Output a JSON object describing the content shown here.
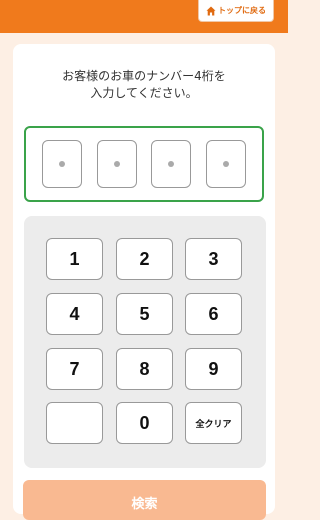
{
  "header": {
    "home_label": "トップに戻る"
  },
  "prompt": {
    "line1": "お客様のお車のナンバー4桁を",
    "line2": "入力してください。"
  },
  "plate_digits": [
    "",
    "",
    "",
    ""
  ],
  "keypad": {
    "keys": [
      "1",
      "2",
      "3",
      "4",
      "5",
      "6",
      "7",
      "8",
      "9",
      "",
      "0",
      "全クリア"
    ]
  },
  "search": {
    "label": "検索"
  },
  "colors": {
    "accent": "#f07a1c",
    "input_border": "#3aa34a",
    "search_disabled": "#f9b991"
  }
}
